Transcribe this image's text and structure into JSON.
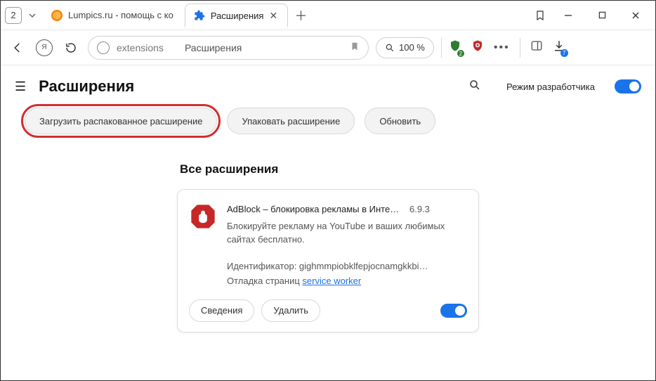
{
  "titlebar": {
    "tab_count": "2",
    "tabs": [
      {
        "label": "Lumpics.ru - помощь с ко"
      },
      {
        "label": "Расширения"
      }
    ]
  },
  "toolbar": {
    "omnibox_host": "extensions",
    "omnibox_title": "Расширения",
    "zoom": "100 %",
    "shield_badge": "2",
    "download_badge": "7"
  },
  "page": {
    "title": "Расширения",
    "devmode_label": "Режим разработчика"
  },
  "dev_buttons": {
    "load_unpacked": "Загрузить распакованное расширение",
    "pack": "Упаковать расширение",
    "update": "Обновить"
  },
  "section_title": "Все расширения",
  "extension": {
    "name": "AdBlock – блокировка рекламы в Интер…",
    "version": "6.9.3",
    "description": "Блокируйте рекламу на YouTube и ваших любимых сайтах бесплатно.",
    "id_line": "Идентификатор: gighmmpiobklfepjocnamgkkbi…",
    "debug_prefix": "Отладка страниц ",
    "debug_link": "service worker",
    "details_btn": "Сведения",
    "remove_btn": "Удалить"
  }
}
